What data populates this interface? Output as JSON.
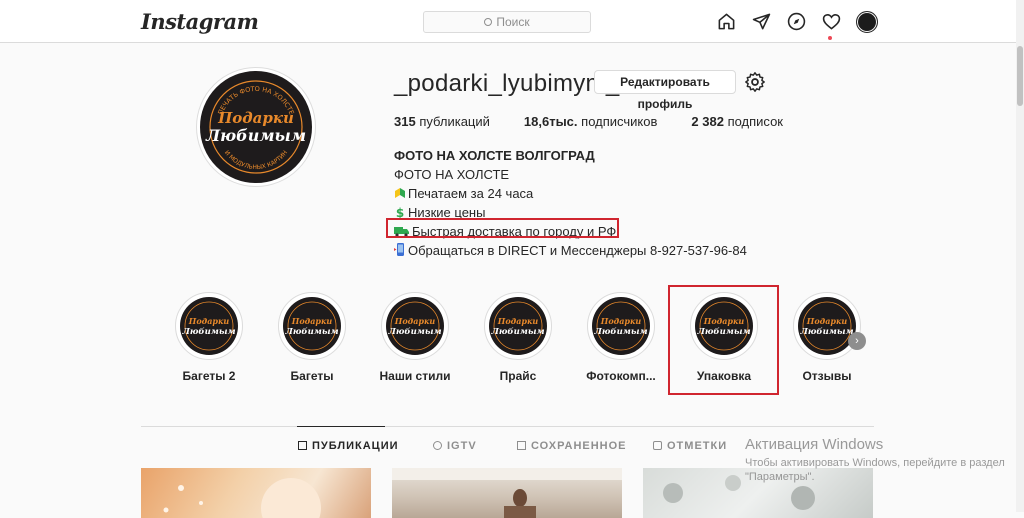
{
  "header": {
    "logo": "Instagram",
    "search_placeholder": "Поиск",
    "nav_icons": [
      "home-icon",
      "direct-icon",
      "explore-icon",
      "activity-heart-icon",
      "profile-avatar"
    ]
  },
  "profile": {
    "username": "_podarki_lyubimym_",
    "edit_button": "Редактировать профиль",
    "stats": {
      "posts_value": "315",
      "posts_label": "публикаций",
      "followers_value": "18,6тыс.",
      "followers_label": "подписчиков",
      "following_value": "2 382",
      "following_label": "подписок"
    },
    "bio": {
      "name": "ФОТО НА ХОЛСТЕ ВОЛГОГРАД",
      "line1": "ФОТО НА ХОЛСТЕ",
      "line2": "Печатаем за 24 часа",
      "line3": "Низкие цены",
      "line4": "Быстрая доставка по городу и РФ",
      "line5": "Обращаться в DIRECT и Мессенджеры 8-927-537-96-84"
    },
    "logo_text": {
      "top": "ПЕЧАТЬ ФОТО НА ХОЛСТЕ",
      "main1": "Подарки",
      "main2": "Любимым",
      "bottom": "И МОДУЛЬНЫХ КАРТИН"
    }
  },
  "highlights": [
    {
      "label": "Багеты 2"
    },
    {
      "label": "Багеты"
    },
    {
      "label": "Наши стили"
    },
    {
      "label": "Прайс"
    },
    {
      "label": "Фотокомп..."
    },
    {
      "label": "Упаковка"
    },
    {
      "label": "Отзывы"
    }
  ],
  "tabs": [
    {
      "label": "ПУБЛИКАЦИИ",
      "icon": "grid-icon",
      "active": true
    },
    {
      "label": "IGTV",
      "icon": "igtv-icon",
      "active": false
    },
    {
      "label": "СОХРАНЕННОЕ",
      "icon": "bookmark-icon",
      "active": false
    },
    {
      "label": "ОТМЕТКИ",
      "icon": "tagged-icon",
      "active": false
    }
  ],
  "watermark": {
    "title": "Активация Windows",
    "text": "Чтобы активировать Windows, перейдите в раздел \"Параметры\"."
  },
  "colors": {
    "accent_red": "#d0252f",
    "logo_orange": "#e8892b",
    "text": "#262626",
    "muted": "#8e8e8e",
    "border": "#dbdbdb"
  }
}
